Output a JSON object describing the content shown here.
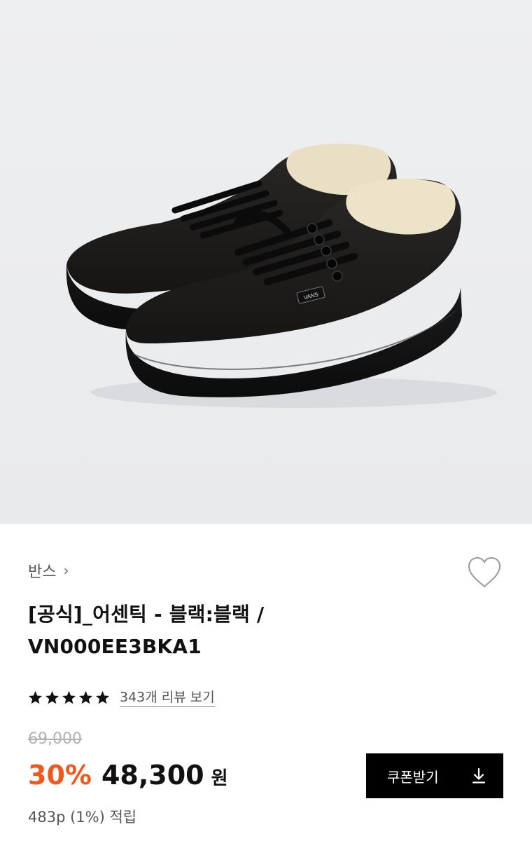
{
  "product_image": {
    "alt": "black-canvas-low-top-sneakers-pair",
    "logo_text": "VANS"
  },
  "brand": {
    "name": "반스",
    "chevron": "›"
  },
  "wishlist": {
    "icon": "heart-outline-icon"
  },
  "title": {
    "line1": "[공식]_어센틱 - 블랙:블랙 /",
    "line2": "VN000EE3BKA1"
  },
  "rating": {
    "stars": 5,
    "review_link": "343개 리뷰 보기"
  },
  "price": {
    "original": "69,000",
    "discount": "30%",
    "sale": "48,300",
    "currency": "원"
  },
  "points": {
    "text": "483p (1%) 적립"
  },
  "coupon_button": {
    "label": "쿠폰받기",
    "icon": "download-icon"
  },
  "colors": {
    "accent": "#ee5a1e",
    "button_bg": "#000000",
    "muted_text": "#555555",
    "strike_price": "#b0b0b0"
  }
}
